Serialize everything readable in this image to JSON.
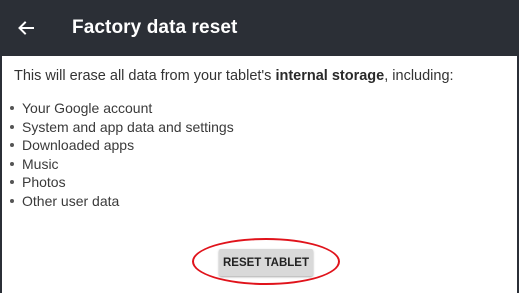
{
  "header": {
    "back_icon": "arrow-back-icon",
    "title": "Factory data reset",
    "background_color": "#2b2f36"
  },
  "intro": {
    "prefix": "This will erase all data from your tablet's ",
    "emphasis": "internal storage",
    "suffix": ", including:"
  },
  "items": [
    "Your Google account",
    "System and app data and settings",
    "Downloaded apps",
    "Music",
    "Photos",
    "Other user data"
  ],
  "reset_button": {
    "label": "RESET TABLET",
    "highlight_color": "#e0131b"
  }
}
